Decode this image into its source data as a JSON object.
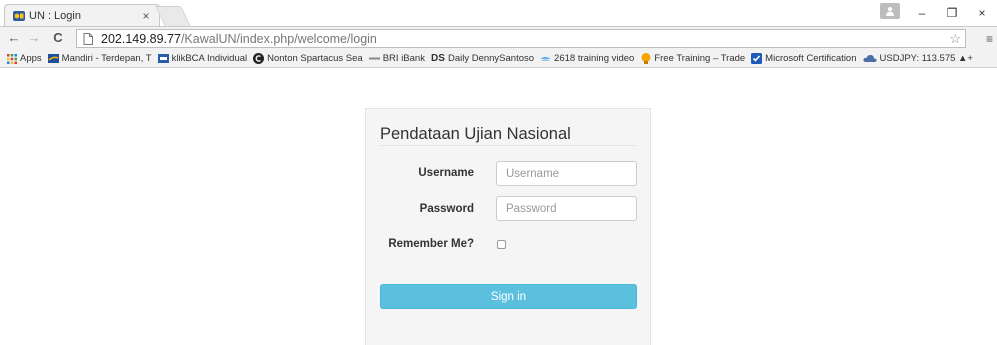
{
  "tab": {
    "title": "UN : Login",
    "close": "×"
  },
  "window_controls": {
    "minimize": "–",
    "restore": "❐",
    "close": "×"
  },
  "toolbar": {
    "back": "←",
    "forward": "→",
    "reload": "C",
    "url_host": "202.149.89.77",
    "url_path": "/KawalUN/index.php/welcome/login",
    "star": "☆",
    "menu": "≡"
  },
  "bookmarks": [
    {
      "label": "Apps",
      "icon": "apps-grid-icon",
      "color": "#e53935"
    },
    {
      "label": "Mandiri - Terdepan, T",
      "icon": "mandiri-icon",
      "color": "#1e4f9c"
    },
    {
      "label": "klikBCA Individual",
      "icon": "bca-icon",
      "color": "#2a5da8"
    },
    {
      "label": "Nonton Spartacus Sea",
      "icon": "circle-c-icon",
      "color": "#222222"
    },
    {
      "label": "BRI iBank",
      "icon": "dash-icon",
      "color": "#8a8a8a"
    },
    {
      "label": "Daily DennySantoso",
      "icon": "ds-icon",
      "color": "#111111"
    },
    {
      "label": "2618 training video",
      "icon": "wing-icon",
      "color": "#1e88e5"
    },
    {
      "label": "Free Training – Trade",
      "icon": "bulb-icon",
      "color": "#f4a300"
    },
    {
      "label": "Microsoft Certification",
      "icon": "checkbox-icon",
      "color": "#1e5bb8"
    },
    {
      "label": "USDJPY: 113.575 ▲+",
      "icon": "cloud-icon",
      "color": "#4a6fa5"
    }
  ],
  "login": {
    "title": "Pendataan Ujian Nasional",
    "username_label": "Username",
    "username_placeholder": "Username",
    "password_label": "Password",
    "password_placeholder": "Password",
    "remember_label": "Remember Me?",
    "signin_label": "Sign in"
  },
  "colors": {
    "signin_bg": "#5bc0de",
    "panel_bg": "#f5f5f5"
  }
}
